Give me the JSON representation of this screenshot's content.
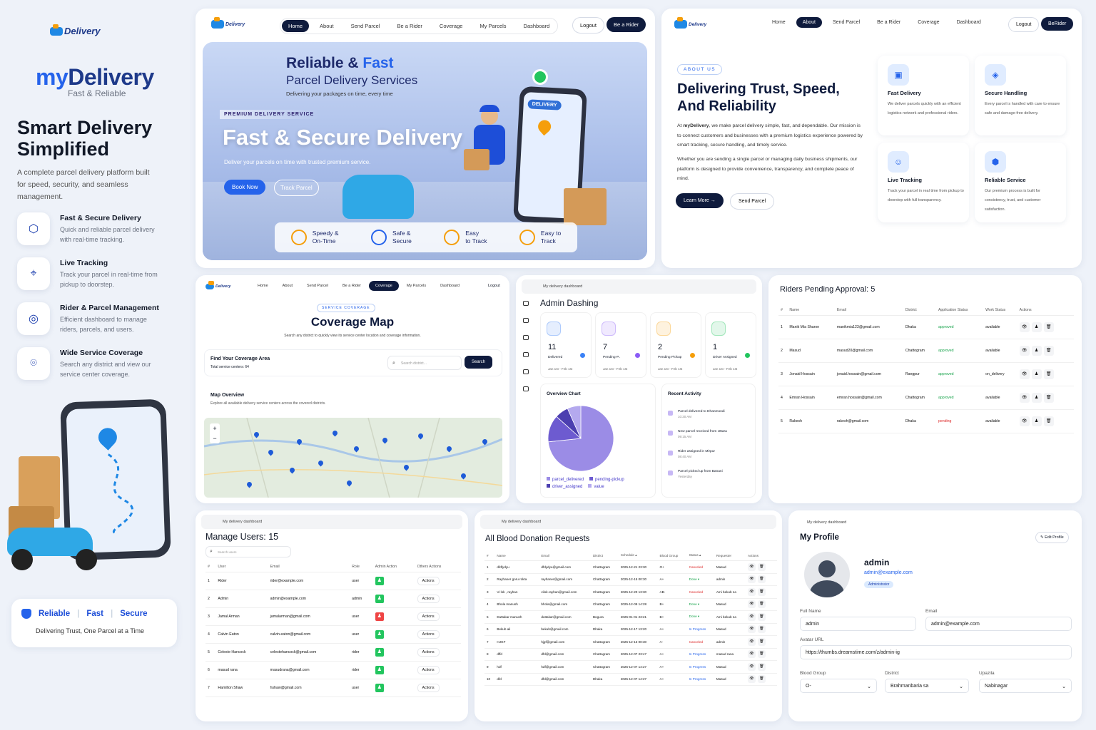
{
  "brand": {
    "logo_text": "Delivery",
    "name_my": "my",
    "name_delivery": "Delivery",
    "tagline": "Fast & Reliable",
    "headline": "Smart Delivery Simplified",
    "description": "A complete parcel delivery platform built for speed, security, and seamless management."
  },
  "features": [
    {
      "icon": "box-icon",
      "title": "Fast & Secure Delivery",
      "desc": "Quick and reliable parcel delivery with real-time tracking."
    },
    {
      "icon": "tracking-icon",
      "title": "Live Tracking",
      "desc": "Track your parcel in real-time from pickup to doorstep."
    },
    {
      "icon": "management-icon",
      "title": "Rider & Parcel Management",
      "desc": "Efficient dashboard to manage riders, parcels, and users."
    },
    {
      "icon": "location-icon",
      "title": "Wide Service Coverage",
      "desc": "Search any district and view our service center coverage."
    }
  ],
  "badge": {
    "words": [
      "Reliable",
      "Fast",
      "Secure"
    ],
    "sub": "Delivering Trust, One Parcel at a Time"
  },
  "nav": {
    "items": [
      "Home",
      "About",
      "Send Parcel",
      "Be a Rider",
      "Coverage",
      "My Parcels",
      "Dashboard"
    ],
    "logout": "Logout",
    "rider": "Be a Rider"
  },
  "nav_about": {
    "items": [
      "Home",
      "About",
      "Send Parcel",
      "Be a Rider",
      "Coverage",
      "Dashboard"
    ],
    "logout": "Logout",
    "rider": "BeRider"
  },
  "nav_cov": {
    "items": [
      "Home",
      "About",
      "Send Parcel",
      "Be a Rider",
      "Coverage",
      "My Parcels",
      "Dashboard"
    ],
    "logout": "Logout"
  },
  "hero": {
    "t1a": "Reliable & ",
    "t1b": "Fast",
    "t2": "Parcel Delivery Services",
    "t3": "Delivering your packages on time, every time",
    "premium": "PREMIUM DELIVERY SERVICE",
    "big": "Fast & Secure Delivery",
    "sub": "Deliver your parcels on time with trusted premium service.",
    "book": "Book Now",
    "track": "Track Parcel",
    "phone_badge": "DELIVERY",
    "perks": [
      {
        "a": "Speedy &",
        "b": "On-Time"
      },
      {
        "a": "Safe &",
        "b": "Secure"
      },
      {
        "a": "Easy",
        "b": "to Track"
      },
      {
        "a": "Easy to",
        "b": "Track"
      }
    ]
  },
  "about": {
    "eyebrow": "ABOUT US",
    "title1": "Delivering Trust, Speed,",
    "title2": "And Reliability",
    "p1a": "At ",
    "p1b": "myDelivery",
    "p1c": ", we make parcel delivery simple, fast, and dependable. Our mission is to connect customers and businesses with a premium logistics experience powered by smart tracking, secure handling, and timely service.",
    "p2": "Whether you are sending a single parcel or managing daily business shipments, our platform is designed to provide convenience, transparency, and complete peace of mind.",
    "learn": "Learn More →",
    "send": "Send Parcel",
    "cards": [
      {
        "icon": "truck-icon",
        "title": "Fast Delivery",
        "desc": "We deliver parcels quickly with an efficient logistics network and professional riders."
      },
      {
        "icon": "shield-icon",
        "title": "Secure Handling",
        "desc": "Every parcel is handled with care to ensure safe and damage-free delivery."
      },
      {
        "icon": "user-icon",
        "title": "Live Tracking",
        "desc": "Track your parcel in real time from pickup to doorstep with full transparency."
      },
      {
        "icon": "cube-icon",
        "title": "Reliable Service",
        "desc": "Our premium process is built for consistency, trust, and customer satisfaction."
      }
    ]
  },
  "coverage": {
    "eyebrow": "SERVICE COVERAGE",
    "title": "Coverage Map",
    "sub": "Search any district to quickly view its service center location and coverage information.",
    "find": "Find Your Coverage Area",
    "total": "Total service centers: 64",
    "placeholder": "Search district...",
    "search": "Search",
    "map_title": "Map Overview",
    "map_sub": "Explore all available delivery service centers across the covered districts."
  },
  "dash": {
    "crumb": "My delivery dashboard",
    "title": "Admin Dashing",
    "stats": [
      {
        "n": "11",
        "l": "Delivered",
        "d": "Jan 1st - Feb 1st",
        "c": "#3b82f6"
      },
      {
        "n": "7",
        "l": "Pending-P..",
        "d": "Jan 1st - Feb 1st",
        "c": "#8b5cf6"
      },
      {
        "n": "2",
        "l": "Pending Pickup",
        "d": "Jan 1st - Feb 1st",
        "c": "#f59e0b"
      },
      {
        "n": "1",
        "l": "Driver Assigned",
        "d": "Jan 1st - Feb 1st",
        "c": "#22c55e"
      }
    ],
    "chart_title": "Overview Chart",
    "activity_title": "Recent Activity",
    "activity": [
      {
        "t": "Parcel delivered to Dhanmondi",
        "s": "10:30 AM"
      },
      {
        "t": "New parcel received from Uttara",
        "s": "09:15 AM"
      },
      {
        "t": "Rider assigned in Mirpur",
        "s": "08:40 AM"
      },
      {
        "t": "Parcel picked up from Banani",
        "s": "Yesterday"
      }
    ]
  },
  "chart_data": {
    "type": "pie",
    "legend": [
      "parcel_delivered",
      "pending-pickup",
      "driver_assigned",
      "value"
    ],
    "values": [
      11,
      2,
      1,
      1
    ],
    "colors": [
      "#9b8ce6",
      "#6d5bd0",
      "#4c3fb0",
      "#b4a9ee"
    ]
  },
  "riders": {
    "title": "Riders Pending Approval: 5",
    "headers": [
      "#",
      "Name",
      "Email",
      "District",
      "Application Status",
      "Work Status",
      "Actions"
    ],
    "rows": [
      [
        "1",
        "Manik Mia Sharon",
        "manikmia123@gmail.com",
        "Dhaka",
        "approved",
        "available"
      ],
      [
        "2",
        "Masud",
        "masud20@gmail.com",
        "Chattogram",
        "approved",
        "available"
      ],
      [
        "3",
        "Jonaid Hossain",
        "jonaid.hossain@gmail.com",
        "Rangpur",
        "approved",
        "on_delivery"
      ],
      [
        "4",
        "Emran Hossain",
        "emran.hossain@gmail.com",
        "Chattogram",
        "approved",
        "available"
      ],
      [
        "5",
        "Rakesh",
        "rakesh@gmail.com",
        "Dhaka",
        "pending",
        "available"
      ]
    ]
  },
  "users": {
    "crumb": "My delivery dashboard",
    "title": "Manage Users: 15",
    "search": "Search users",
    "headers": [
      "#",
      "User",
      "Email",
      "Role",
      "Admin Action",
      "Others Actions"
    ],
    "action": "Actions",
    "rows": [
      [
        "1",
        "Rider",
        "rider@example.com",
        "user",
        "g"
      ],
      [
        "2",
        "Admin",
        "admin@example.com",
        "admin",
        "g"
      ],
      [
        "3",
        "Jamal Arman",
        "jamalarman@gmail.com",
        "user",
        "r"
      ],
      [
        "4",
        "Calvin Eaton",
        "calvin.eaton@gmail.com",
        "user",
        "g"
      ],
      [
        "5",
        "Celeste Hancock",
        "celestehancock@gmail.com",
        "rider",
        "g"
      ],
      [
        "6",
        "masud rana",
        "masudrana@gmail.com",
        "rider",
        "g"
      ],
      [
        "7",
        "Hamilton Shaw",
        "hshaw@gmail.com",
        "user",
        "g"
      ]
    ]
  },
  "blood": {
    "crumb": "My delivery dashboard",
    "title": "All Blood Donation Requests",
    "headers": [
      "#",
      "Name",
      "Email",
      "District",
      "Schedule ▴",
      "Blood Group",
      "Status ▴",
      "Requester",
      "Actions"
    ],
    "rows": [
      [
        "1",
        "dfdfydyu",
        "dfdydyu@gmail.com",
        "Chattogram",
        "2025-12-21 23:30",
        "O+",
        "Canceled",
        "Masud"
      ],
      [
        "2",
        "Rayhaner goru rokta",
        "rayhaner@gmail.com",
        "Chattogram",
        "2025-12-15 00:30",
        "A+",
        "Done ▾",
        "admin"
      ],
      [
        "3",
        "Vi lok , rayhan",
        "vilok.rayhan@gmail.com",
        "Chattogram",
        "2025-12-20 13:30",
        "AB-",
        "Canceled",
        "Ami bekub na"
      ],
      [
        "4",
        "Bhola manush",
        "bhola@gmail.com",
        "Chattogram",
        "2025-12-09 14:28",
        "B+",
        "Done ▾",
        "Masud"
      ],
      [
        "5",
        "Duttakar manush",
        "duttakar@gmail.com",
        "Bogura",
        "2025-01-01 23:21",
        "B+",
        "Done ▾",
        "Ami bekub na"
      ],
      [
        "6",
        "Bekub ali",
        "bekub@gmail.com",
        "Dhaka",
        "2025-12-17 13:20",
        "A+",
        "In Progress",
        "Masud"
      ],
      [
        "7",
        "HJGF",
        "hjgf@gmail.com",
        "Chattogram",
        "2025-12-13 00:30",
        "A-",
        "Canceled",
        "admin"
      ],
      [
        "8",
        "dffd",
        "dfd@gmail.com",
        "Chattogram",
        "2025-12-07 23:47",
        "A+",
        "In Progress",
        "masud rana"
      ],
      [
        "9",
        "hdf",
        "hdf@gmail.com",
        "Chattogram",
        "2025-12-07 14:27",
        "A+",
        "In Progress",
        "Masud"
      ],
      [
        "10",
        "dfd",
        "dfd@gmail.com",
        "Dhaka",
        "2025-12-07 14:27",
        "A+",
        "In Progress",
        "Masud"
      ]
    ]
  },
  "profile": {
    "crumb": "My delivery dashboard",
    "title": "My Profile",
    "edit": "✎ Edit Profile",
    "name": "admin",
    "email": "admin@example.com",
    "role": "Administrator",
    "full_label": "Full Name",
    "full": "admin",
    "email_label": "Email",
    "email_val": "admin@example.com",
    "avatar_label": "Avatar URL",
    "avatar": "https://thumbs.dreamstime.com/z/admin-ig",
    "blood_label": "Blood Group",
    "blood": "O-",
    "district_label": "District",
    "district": "Brahmanbaria sa",
    "upazila_label": "Upazila",
    "upazila": "Nabinagar"
  }
}
